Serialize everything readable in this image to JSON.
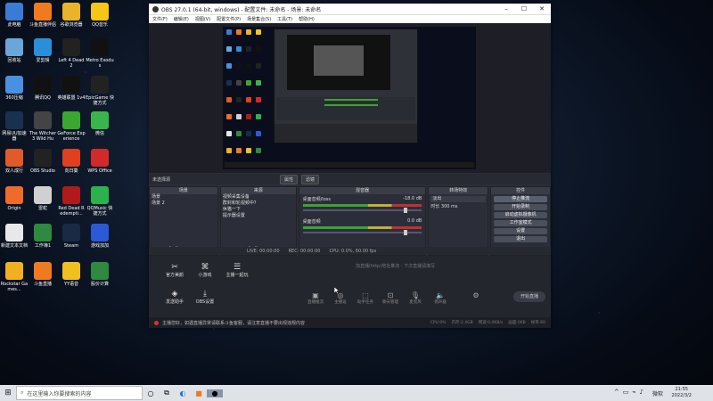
{
  "desktop_icons": [
    {
      "label": "此电脑",
      "color": "#3a7bd5"
    },
    {
      "label": "斗鱼直播伴侣",
      "color": "#f07a20"
    },
    {
      "label": "谷歌浏览器",
      "color": "#e8b52a"
    },
    {
      "label": "QQ音乐",
      "color": "#f5c518"
    },
    {
      "label": "回收站",
      "color": "#6aa7d8"
    },
    {
      "label": "爱剪辑",
      "color": "#2a8fd8"
    },
    {
      "label": "Left 4 Dead 2",
      "color": "#222"
    },
    {
      "label": "Metro Exodus",
      "color": "#111"
    },
    {
      "label": "360压缩",
      "color": "#4a90e2"
    },
    {
      "label": "腾讯QQ",
      "color": "#111"
    },
    {
      "label": "英雄联盟 1v4",
      "color": "#111"
    },
    {
      "label": "EpicGame 快捷方式",
      "color": "#222"
    },
    {
      "label": "网易UU加速器",
      "color": "#1a3050"
    },
    {
      "label": "The Witcher 3 Wild Hu",
      "color": "#444"
    },
    {
      "label": "GeForce Experience",
      "color": "#3aa830"
    },
    {
      "label": "微信",
      "color": "#3ab54a"
    },
    {
      "label": "双人成行",
      "color": "#e05a2a"
    },
    {
      "label": "OBS Studio",
      "color": "#222"
    },
    {
      "label": "向日葵",
      "color": "#e04020"
    },
    {
      "label": "WPS Office",
      "color": "#d22a2a"
    },
    {
      "label": "Origin",
      "color": "#f06a2a"
    },
    {
      "label": "雷蛇",
      "color": "#d0d0d0"
    },
    {
      "label": "Red Dead Redempti...",
      "color": "#b01a1a"
    },
    {
      "label": "QQMusic 快捷方式",
      "color": "#2bb24c"
    },
    {
      "label": "新建文本文档",
      "color": "#e8e8e8"
    },
    {
      "label": "工作簿1",
      "color": "#2e8a3e"
    },
    {
      "label": "Steam",
      "color": "#1a2a44"
    },
    {
      "label": "游戏加加",
      "color": "#2a5ad8"
    },
    {
      "label": "Rockstar Games...",
      "color": "#f0b020"
    },
    {
      "label": "斗鱼直播",
      "color": "#f07a20"
    },
    {
      "label": "YY语音",
      "color": "#f0c020"
    },
    {
      "label": "股价计算",
      "color": "#2e8a3e"
    }
  ],
  "obs": {
    "title": "OBS 27.0.1 (64-bit, windows) - 配置文件: 未命名 - 场景: 未命名",
    "menu": [
      "文件(F)",
      "编辑(E)",
      "视图(V)",
      "配置文件(P)",
      "场景集合(S)",
      "工具(T)",
      "帮助(H)"
    ],
    "source_line": "未选择源",
    "props_btn": "属性",
    "filter_btn": "滤镜",
    "docks": {
      "scenes": {
        "title": "场景",
        "items": [
          "场景",
          "场景 2"
        ]
      },
      "sources": {
        "title": "来源",
        "items": [
          "视频采集设备",
          "群封和轮视频中?",
          "休猫一下",
          "提示器设置"
        ]
      },
      "mixer": {
        "title": "混音器",
        "ch1": "桌面音频/loss",
        "ch1_db": "-18.0 dB",
        "ch2": "桌面音频",
        "ch2_db": "0.0 dB"
      },
      "transition": {
        "title": "转场特效",
        "mode": "淡出",
        "dur_label": "时长",
        "dur": "300 ms"
      },
      "controls": {
        "title": "控件",
        "buttons": [
          "停止推流",
          "开始录制",
          "启动虚拟摄像机",
          "工作室模式",
          "设置",
          "退出"
        ]
      }
    },
    "status": {
      "live": "LIVE: 00:00:00",
      "rec": "REC: 00:00:00",
      "cpu": "CPU: 0.0%, 60.00 fps"
    }
  },
  "huya": {
    "tools": [
      "官方美颜",
      "小游戏",
      "主播一起玩",
      "发送助手",
      "OBS设置"
    ],
    "hint": "加直播(http)地址推流 - 下次直播请填写",
    "controls": [
      "直播推流",
      "主播设",
      "助手任务",
      "聊天管理",
      "麦克风",
      "扬声器"
    ],
    "start": "开始直播",
    "notice": "主播您好，如遇直播异常请联系斗鱼客服，请注意直播不要出现违规内容",
    "stats": [
      "CPU:0%",
      "内存:2.4GB",
      "网速:0.0KB/s",
      "画面:0KB",
      "帧率:60"
    ]
  },
  "taskbar": {
    "search_placeholder": "在这里输入你要搜索的内容",
    "ime": "微软",
    "time": "21:55",
    "date": "2022/3/2"
  }
}
